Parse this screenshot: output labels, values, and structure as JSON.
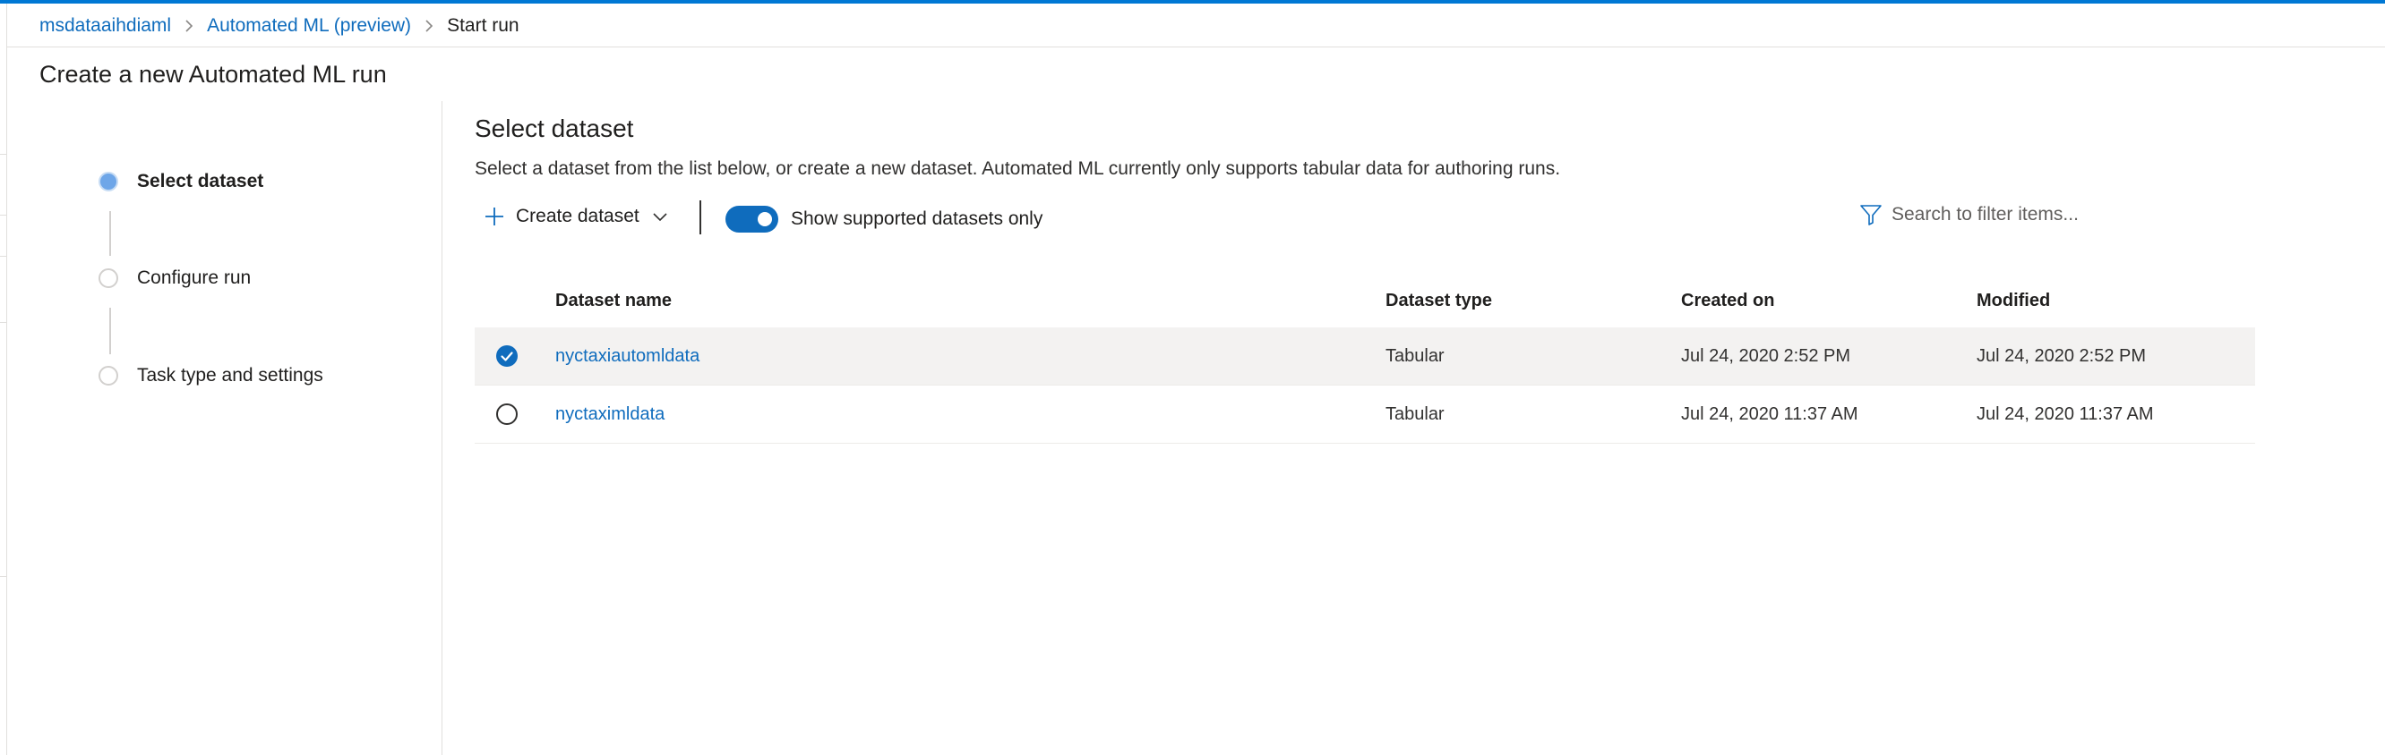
{
  "breadcrumb": {
    "workspace": "msdataaihdiaml",
    "section": "Automated ML (preview)",
    "current": "Start run"
  },
  "page_title": "Create a new Automated ML run",
  "steps": [
    {
      "label": "Select dataset",
      "state": "active"
    },
    {
      "label": "Configure run",
      "state": "pending"
    },
    {
      "label": "Task type and settings",
      "state": "pending"
    }
  ],
  "main": {
    "title": "Select dataset",
    "description": "Select a dataset from the list below, or create a new dataset. Automated ML currently only supports tabular data for authoring runs."
  },
  "toolbar": {
    "create_label": "Create dataset",
    "toggle_label": "Show supported datasets only",
    "toggle_on": true,
    "search_placeholder": "Search to filter items..."
  },
  "table": {
    "columns": [
      "Dataset name",
      "Dataset type",
      "Created on",
      "Modified"
    ],
    "rows": [
      {
        "name": "nyctaxiautomldata",
        "type": "Tabular",
        "created": "Jul 24, 2020 2:52 PM",
        "modified": "Jul 24, 2020 2:52 PM",
        "selected": true
      },
      {
        "name": "nyctaximldata",
        "type": "Tabular",
        "created": "Jul 24, 2020 11:37 AM",
        "modified": "Jul 24, 2020 11:37 AM",
        "selected": false
      }
    ]
  },
  "colors": {
    "accent": "#0f6cbd",
    "top_bar": "#0078d4",
    "selected_row": "#f3f2f1"
  },
  "icons": [
    "chevron-right-icon",
    "plus-icon",
    "chevron-down-icon",
    "filter-icon",
    "checkmark-icon"
  ]
}
